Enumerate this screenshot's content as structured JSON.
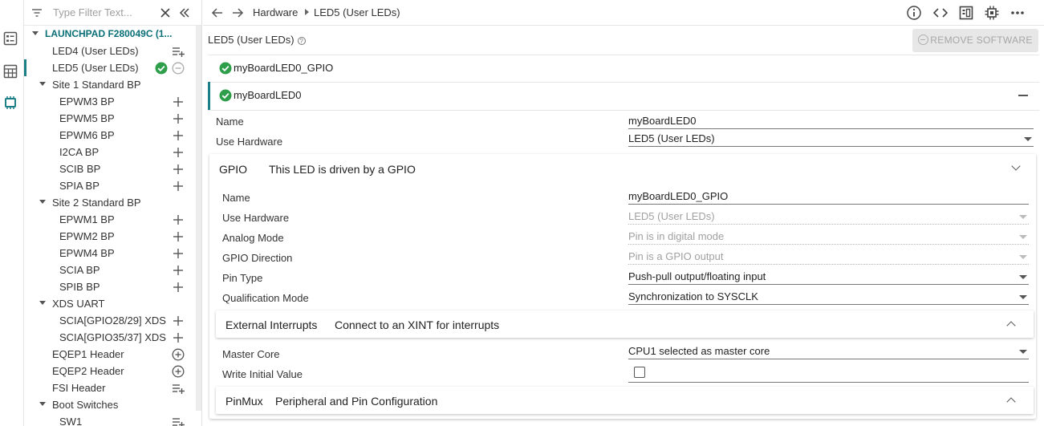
{
  "colors": {
    "accent": "#1a7f86",
    "success": "#2e9e4a"
  },
  "rail": {
    "icons": [
      "outline-list-icon",
      "calculator-grid-icon",
      "chip-icon"
    ]
  },
  "tree": {
    "filter_placeholder": "Type Filter Text...",
    "root_label": "LAUNCHPAD F280049C (1...",
    "items": [
      {
        "label": "LED4 (User LEDs)",
        "kind": "leaf"
      },
      {
        "label": "LED5 (User LEDs)",
        "kind": "leaf-selected"
      },
      {
        "label": "Site 1 Standard BP",
        "kind": "group"
      },
      {
        "label": "EPWM3 BP",
        "kind": "child"
      },
      {
        "label": "EPWM5 BP",
        "kind": "child"
      },
      {
        "label": "EPWM6 BP",
        "kind": "child"
      },
      {
        "label": "I2CA BP",
        "kind": "child"
      },
      {
        "label": "SCIB BP",
        "kind": "child"
      },
      {
        "label": "SPIA BP",
        "kind": "child"
      },
      {
        "label": "Site 2 Standard BP",
        "kind": "group"
      },
      {
        "label": "EPWM1 BP",
        "kind": "child"
      },
      {
        "label": "EPWM2 BP",
        "kind": "child"
      },
      {
        "label": "EPWM4 BP",
        "kind": "child"
      },
      {
        "label": "SCIA BP",
        "kind": "child"
      },
      {
        "label": "SPIB BP",
        "kind": "child"
      },
      {
        "label": "XDS UART",
        "kind": "group"
      },
      {
        "label": "SCIA[GPIO28/29] XDS",
        "kind": "child"
      },
      {
        "label": "SCIA[GPIO35/37] XDS",
        "kind": "child"
      },
      {
        "label": "EQEP1 Header",
        "kind": "leaf-circle"
      },
      {
        "label": "EQEP2 Header",
        "kind": "leaf-circle"
      },
      {
        "label": "FSI Header",
        "kind": "leaf"
      },
      {
        "label": "Boot Switches",
        "kind": "group"
      },
      {
        "label": "SW1",
        "kind": "child-list"
      }
    ]
  },
  "toolbar": {
    "breadcrumb": [
      "Hardware",
      "LED5 (User LEDs)"
    ],
    "icons": [
      "info-icon",
      "code-icon",
      "board-view-icon",
      "chip-view-icon",
      "more-icon"
    ]
  },
  "main": {
    "header_title": "LED5 (User LEDs)",
    "remove_button": "REMOVE SOFTWARE",
    "instances": [
      "myBoardLED0_GPIO",
      "myBoardLED0"
    ],
    "fields": [
      {
        "label": "Name",
        "value": "myBoardLED0"
      },
      {
        "label": "Use Hardware",
        "value": "LED5 (User LEDs)"
      }
    ],
    "gpio": {
      "title": "GPIO",
      "subtitle": "This LED is driven by a GPIO",
      "fields": [
        {
          "label": "Name",
          "value": "myBoardLED0_GPIO"
        },
        {
          "label": "Use Hardware",
          "value": "LED5 (User LEDs)"
        },
        {
          "label": "Analog Mode",
          "value": "Pin is in digital mode"
        },
        {
          "label": "GPIO Direction",
          "value": "Pin is a GPIO output"
        },
        {
          "label": "Pin Type",
          "value": "Push-pull output/floating input"
        },
        {
          "label": "Qualification Mode",
          "value": "Synchronization to SYSCLK"
        }
      ],
      "ext_interrupts": {
        "title": "External Interrupts",
        "subtitle": "Connect to an XINT for interrupts"
      },
      "more_fields": [
        {
          "label": "Master Core",
          "value": "CPU1 selected as master core"
        },
        {
          "label": "Write Initial Value",
          "value": ""
        }
      ],
      "pinmux": {
        "title": "PinMux",
        "subtitle": "Peripheral and Pin Configuration"
      }
    }
  }
}
